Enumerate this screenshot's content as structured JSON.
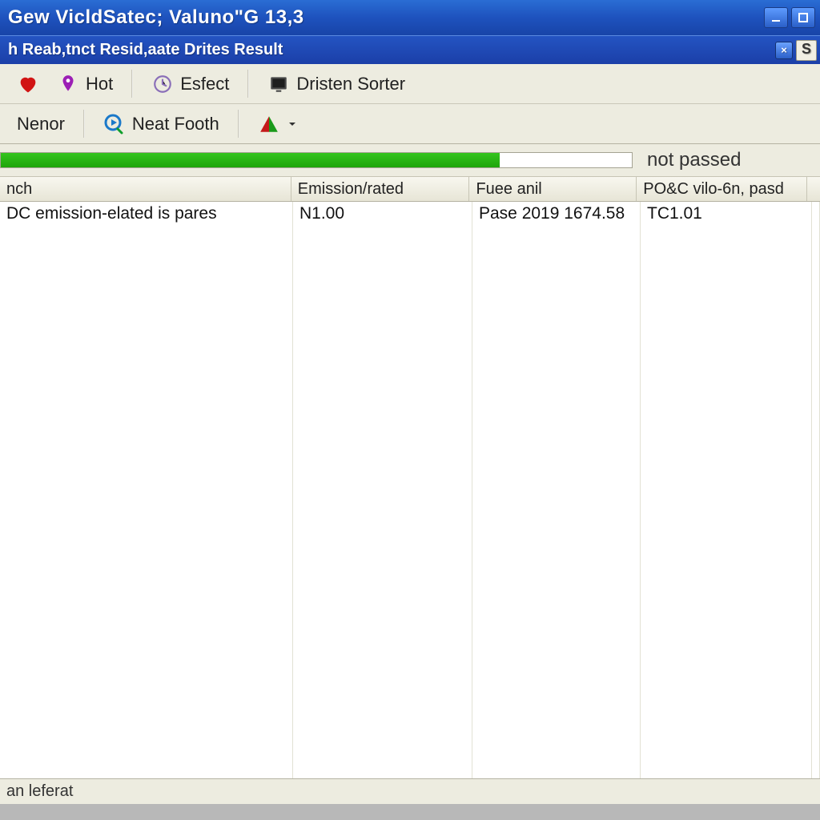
{
  "window": {
    "title": "Gew VicldSatec; Valuno\"G  13,3",
    "subtitle": "h Reab,tnct Resid,aate Drites Result",
    "sbtn": "S"
  },
  "toolbar1": {
    "hot": "Hot",
    "esfect": "Esfect",
    "sorter": "Dristen Sorter"
  },
  "toolbar2": {
    "nenor": "Nenor",
    "neatfooth": "Neat Footh"
  },
  "progress": {
    "percent": 79,
    "label": "not passed"
  },
  "columns": [
    "nch",
    "Emission/rated",
    "Fuee anil",
    "PO&C vilo-6n, pasd",
    ""
  ],
  "rows": [
    {
      "c0": "DC emission-elated is pares",
      "c1": "N1.00",
      "c2": "Pase 2019 1674.58",
      "c3": "TC1.01"
    }
  ],
  "status": "an leferat"
}
